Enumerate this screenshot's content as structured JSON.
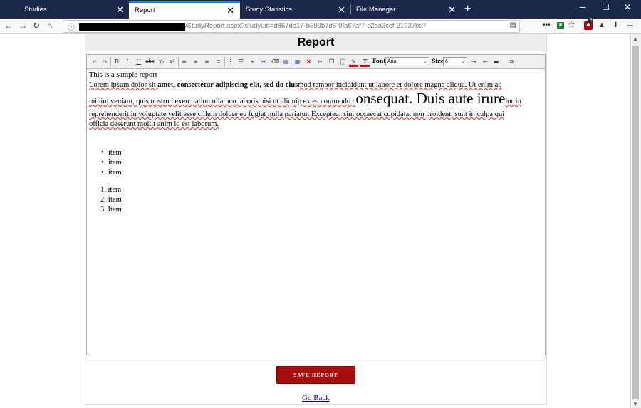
{
  "browser": {
    "tabs": [
      {
        "label": "Studies"
      },
      {
        "label": "Report"
      },
      {
        "label": "Study Statistics"
      },
      {
        "label": "File Manager"
      }
    ],
    "url_text": "/StudyReport.aspx?studyuid=d867dd17-b309b7d6-9fa67af7-c2aa3ccf-21937bd7",
    "ext_badge": "5"
  },
  "page": {
    "title": "Report",
    "toolbar": {
      "bold": "B",
      "italic": "I",
      "underline": "U",
      "strike": "abc",
      "subscript": "x₂",
      "superscript": "x²",
      "font_label": "Font",
      "font_value": "Arial",
      "size_label": "Size",
      "size_value": "6"
    },
    "content": {
      "line1": "This is a sample report",
      "p2_a": "Lorem ipsum dolor sit ",
      "p2_bold": "amet, consectetur adipiscing elit, sed do eius",
      "p2_b": "mod tempor incididunt ut labore et dolore magna aliqua. Ut enim ad",
      "p3_a": "minim veniam, quis nostrud exercitation ullamco laboris nisi ut aliquip ex ea commodo c",
      "p3_big": "onsequat. Duis aute irure",
      "p3_b": "lor in",
      "p4": "reprehenderit in voluptate velit esse cillum dolore eu fugiat nulla pariatur. Excepteur sint occaecat cupidatat non proident, sunt in culpa qui",
      "p5": "officia deserunt mollit anim id est laborum.",
      "bullets": [
        "item",
        "item",
        "item"
      ],
      "numbered": [
        "1. item",
        "2. Item",
        "3. Item"
      ]
    },
    "save_button": "SAVE REPORT",
    "go_back": "Go Back"
  }
}
